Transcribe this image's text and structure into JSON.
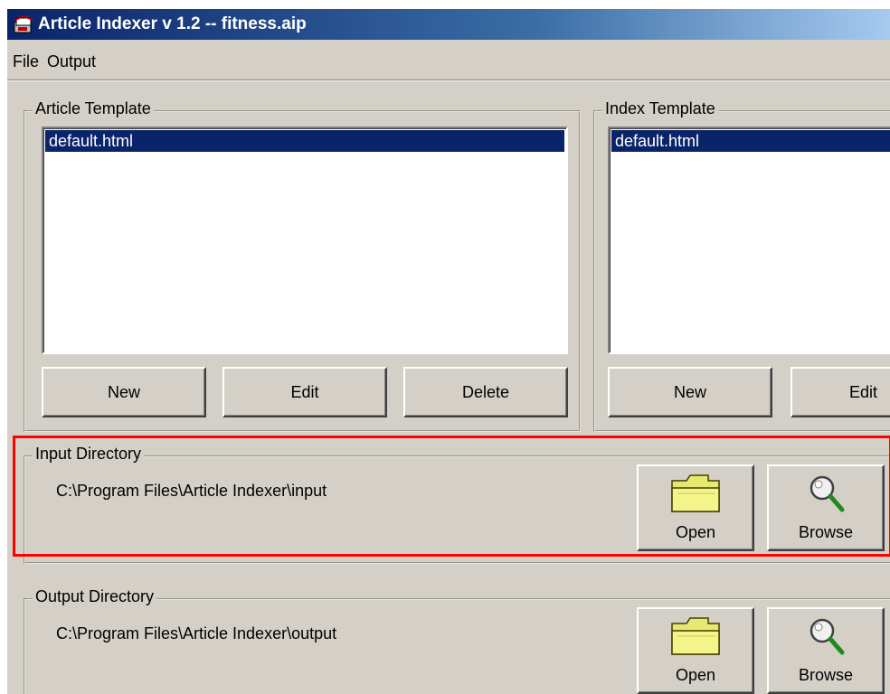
{
  "window": {
    "title": "Article Indexer v 1.2  --  fitness.aip"
  },
  "menu": {
    "file_label": "File",
    "output_label": "Output"
  },
  "article_template": {
    "legend": "Article Template",
    "items": [
      "default.html"
    ],
    "new_label": "New",
    "edit_label": "Edit",
    "delete_label": "Delete"
  },
  "index_template": {
    "legend": "Index Template",
    "items": [
      "default.html"
    ],
    "new_label": "New",
    "edit_label": "Edit"
  },
  "input_directory": {
    "legend": "Input Directory",
    "path": "C:\\Program Files\\Article Indexer\\input",
    "open_label": "Open",
    "browse_label": "Browse"
  },
  "output_directory": {
    "legend": "Output Directory",
    "path": "C:\\Program Files\\Article Indexer\\output",
    "open_label": "Open",
    "browse_label": "Browse"
  },
  "colors": {
    "highlight": "#ff0000",
    "selection": "#0a246a",
    "face": "#d4d0c8"
  }
}
